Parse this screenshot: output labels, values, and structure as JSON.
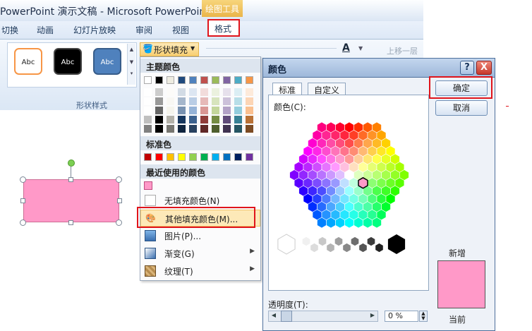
{
  "window": {
    "title": "PowerPoint 演示文稿 - Microsoft PowerPoint",
    "contextual_tab": "绘图工具"
  },
  "ribbon": {
    "tabs": [
      "切换",
      "动画",
      "幻灯片放映",
      "审阅",
      "视图"
    ],
    "active_tab": "格式",
    "shape_styles": [
      "Abc",
      "Abc",
      "Abc"
    ],
    "group_label": "形状样式",
    "fill_button": "形状填充",
    "bring_forward": "上移一层"
  },
  "fill_menu": {
    "theme_colors_header": "主题颜色",
    "standard_colors_header": "标准色",
    "recent_colors_header": "最近使用的颜色",
    "theme_top_row": [
      "#ffffff",
      "#000000",
      "#eeece1",
      "#1f497d",
      "#4f81bd",
      "#c0504d",
      "#9bbb59",
      "#8064a2",
      "#4bacc6",
      "#f79646"
    ],
    "standard_colors": [
      "#c00000",
      "#ff0000",
      "#ffc000",
      "#ffff00",
      "#92d050",
      "#00b050",
      "#00b0f0",
      "#0070c0",
      "#002060",
      "#7030a0"
    ],
    "recent_colors": [
      "#ff99c8"
    ],
    "items": [
      {
        "label": "无填充颜色(N)",
        "icon": "no-fill-icon",
        "submenu": false
      },
      {
        "label": "其他填充颜色(M)...",
        "icon": "palette-icon",
        "submenu": false
      },
      {
        "label": "图片(P)...",
        "icon": "picture-icon",
        "submenu": false
      },
      {
        "label": "渐变(G)",
        "icon": "gradient-icon",
        "submenu": true
      },
      {
        "label": "纹理(T)",
        "icon": "texture-icon",
        "submenu": true
      }
    ]
  },
  "color_dialog": {
    "title": "颜色",
    "help": "?",
    "close": "X",
    "tabs": [
      "标准",
      "自定义"
    ],
    "active_tab": "标准",
    "colors_label": "颜色(C):",
    "ok_button": "确定",
    "cancel_button": "取消",
    "new_label": "新增",
    "current_label": "当前",
    "new_color": "#ff99c8",
    "transparency_label": "透明度(T):",
    "transparency_value": "0 %"
  },
  "slide": {
    "shape_fill": "#ff99c8"
  }
}
